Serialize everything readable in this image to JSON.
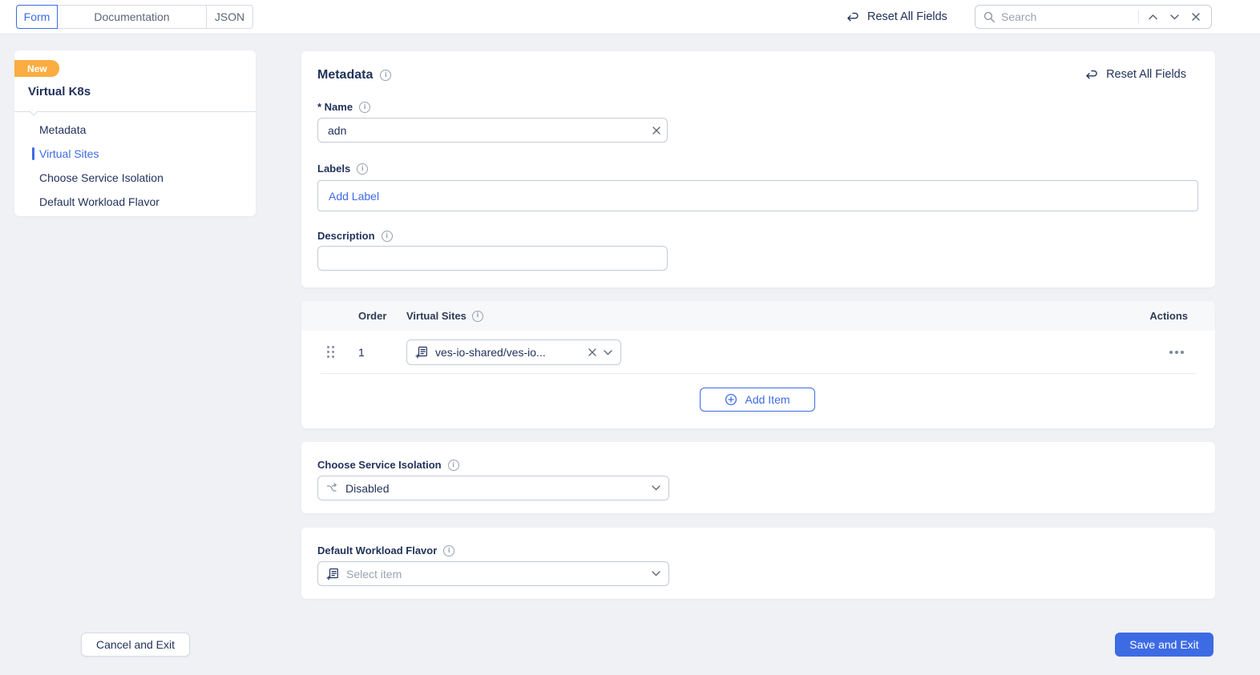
{
  "colors": {
    "accent_blue": "#3D6BE4",
    "badge_orange": "#FBAD41",
    "navy_text": "#22325B",
    "page_bg": "#EFF1F4",
    "table_header_bg": "#F7F8FA"
  },
  "icons": {
    "reset": "undo-curved-arrow",
    "search": "magnifier",
    "info": "circled-i",
    "clear": "x-cross",
    "dropdown": "chevron-down",
    "row_drag": "six-dot-handle",
    "row_actions": "horizontal-ellipsis",
    "reference_select": "form-with-plus",
    "service_isolation": "split-branch-arrow",
    "add_item": "plus-in-circle"
  },
  "topbar": {
    "tabs": [
      {
        "label": "Form",
        "active": true
      },
      {
        "label": "Documentation",
        "active": false
      },
      {
        "label": "JSON",
        "active": false
      }
    ],
    "reset_all_label": "Reset All Fields",
    "search": {
      "placeholder": "Search"
    }
  },
  "sidebar": {
    "badge": "New",
    "title": "Virtual K8s",
    "items": [
      {
        "label": "Metadata",
        "active": false
      },
      {
        "label": "Virtual Sites",
        "active": true
      },
      {
        "label": "Choose Service Isolation",
        "active": false
      },
      {
        "label": "Default Workload Flavor",
        "active": false
      }
    ]
  },
  "metadata": {
    "title": "Metadata",
    "reset_all_label": "Reset All Fields",
    "name_label": "* Name",
    "name_value": "adn",
    "labels_label": "Labels",
    "add_label_button": "Add Label",
    "description_label": "Description",
    "description_value": ""
  },
  "virtual_sites": {
    "columns": {
      "order": "Order",
      "sites": "Virtual Sites",
      "actions": "Actions"
    },
    "rows": [
      {
        "order": "1",
        "site": "ves-io-shared/ves-io..."
      }
    ],
    "add_item_label": "Add Item"
  },
  "service_isolation": {
    "label": "Choose Service Isolation",
    "value": "Disabled"
  },
  "workload_flavor": {
    "label": "Default Workload Flavor",
    "placeholder": "Select item"
  },
  "footer": {
    "cancel_label": "Cancel and Exit",
    "save_label": "Save and Exit"
  }
}
